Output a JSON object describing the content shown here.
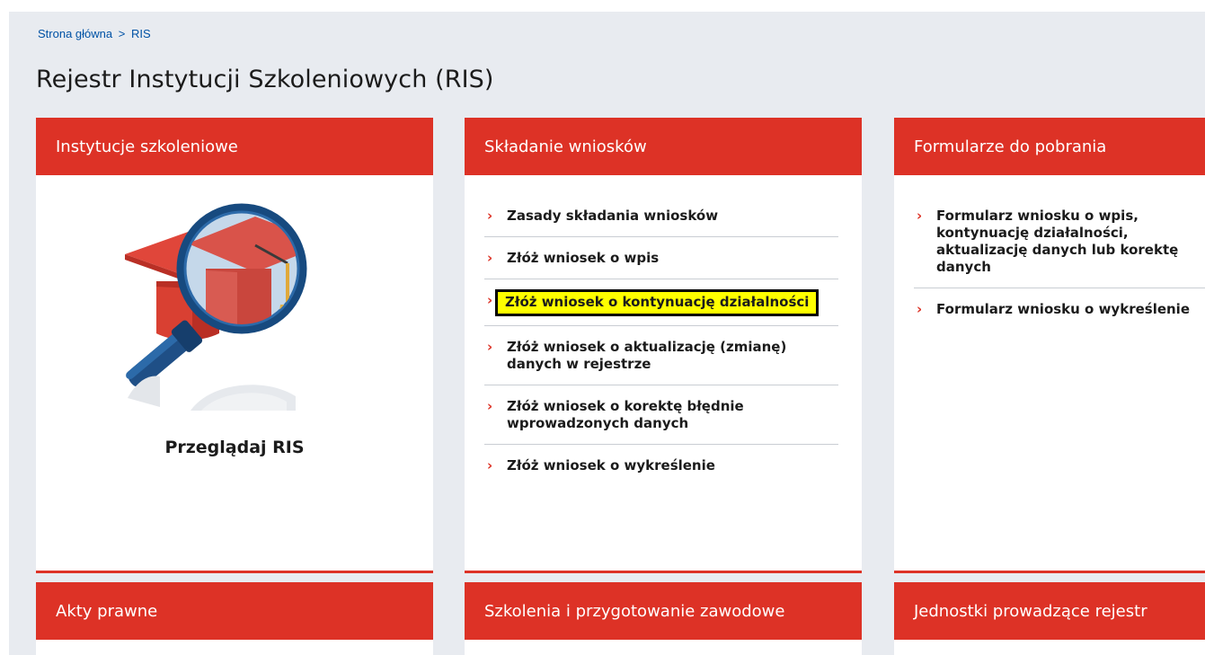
{
  "breadcrumb": {
    "home": "Strona główna",
    "separator": ">",
    "current": "RIS"
  },
  "page_title": "Rejestr Instytucji Szkoleniowych (RIS)",
  "colors": {
    "accent": "#dd3226",
    "link": "#0052a5",
    "background": "#e8ebf0",
    "highlight": "#ffff00"
  },
  "cards": {
    "institutions": {
      "title": "Instytucje szkoleniowe",
      "icon": "graduation-cap-magnifier-icon",
      "browse_label": "Przeglądaj RIS"
    },
    "applications": {
      "title": "Składanie wniosków",
      "links": [
        "Zasady składania wniosków",
        "Złóż wniosek o wpis",
        "Złóż wniosek o kontynuację działalności",
        "Złóż wniosek o aktualizację (zmianę) danych w rejestrze",
        "Złóż wniosek o korektę błędnie wprowadzonych danych",
        "Złóż wniosek o wykreślenie"
      ]
    },
    "forms": {
      "title": "Formularze do pobrania",
      "links": [
        "Formularz wniosku o wpis, kontynuację działalności, aktualizację danych lub korektę danych",
        "Formularz wniosku o wykreślenie"
      ]
    },
    "legal": {
      "title": "Akty prawne"
    },
    "training": {
      "title": "Szkolenia i przygotowanie zawodowe"
    },
    "units": {
      "title": "Jednostki prowadzące rejestr"
    }
  }
}
